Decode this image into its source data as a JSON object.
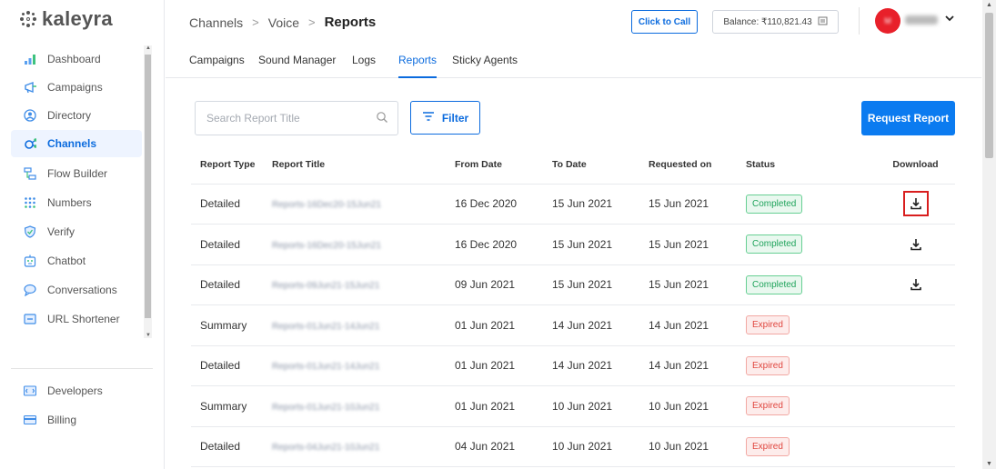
{
  "brand": {
    "name": "kaleyra"
  },
  "sidebar": {
    "items": [
      {
        "label": "Dashboard",
        "icon": "bar-chart-icon"
      },
      {
        "label": "Campaigns",
        "icon": "megaphone-icon"
      },
      {
        "label": "Directory",
        "icon": "contact-icon"
      },
      {
        "label": "Channels",
        "icon": "channels-icon",
        "active": true
      },
      {
        "label": "Flow Builder",
        "icon": "flow-icon"
      },
      {
        "label": "Numbers",
        "icon": "dialpad-icon"
      },
      {
        "label": "Verify",
        "icon": "shield-icon"
      },
      {
        "label": "Chatbot",
        "icon": "chatbot-icon"
      },
      {
        "label": "Conversations",
        "icon": "chat-bubble-icon"
      },
      {
        "label": "URL Shortener",
        "icon": "link-icon"
      }
    ],
    "bottom_items": [
      {
        "label": "Developers",
        "icon": "code-icon"
      },
      {
        "label": "Billing",
        "icon": "card-icon"
      }
    ]
  },
  "header": {
    "breadcrumb": [
      "Channels",
      "Voice",
      "Reports"
    ],
    "click_to_call": "Click to Call",
    "balance": "Balance: ₹110,821.43"
  },
  "tabs": [
    "Campaigns",
    "Sound Manager",
    "Logs",
    "Reports",
    "Sticky Agents"
  ],
  "active_tab": "Reports",
  "search": {
    "placeholder": "Search Report Title"
  },
  "filter_label": "Filter",
  "request_label": "Request Report",
  "table": {
    "columns": [
      "Report Type",
      "Report Title",
      "From Date",
      "To Date",
      "Requested on",
      "Status",
      "Download"
    ],
    "rows": [
      {
        "type": "Detailed",
        "title": "Reports-16Dec20-15Jun21",
        "from": "16 Dec 2020",
        "to": "15 Jun 2021",
        "requested": "15 Jun 2021",
        "status": "Completed"
      },
      {
        "type": "Detailed",
        "title": "Reports-16Dec20-15Jun21",
        "from": "16 Dec 2020",
        "to": "15 Jun 2021",
        "requested": "15 Jun 2021",
        "status": "Completed"
      },
      {
        "type": "Detailed",
        "title": "Reports-09Jun21-15Jun21",
        "from": "09 Jun 2021",
        "to": "15 Jun 2021",
        "requested": "15 Jun 2021",
        "status": "Completed"
      },
      {
        "type": "Summary",
        "title": "Reports-01Jun21-14Jun21",
        "from": "01 Jun 2021",
        "to": "14 Jun 2021",
        "requested": "14 Jun 2021",
        "status": "Expired"
      },
      {
        "type": "Detailed",
        "title": "Reports-01Jun21-14Jun21",
        "from": "01 Jun 2021",
        "to": "14 Jun 2021",
        "requested": "14 Jun 2021",
        "status": "Expired"
      },
      {
        "type": "Summary",
        "title": "Reports-01Jun21-10Jun21",
        "from": "01 Jun 2021",
        "to": "10 Jun 2021",
        "requested": "10 Jun 2021",
        "status": "Expired"
      },
      {
        "type": "Detailed",
        "title": "Reports-04Jun21-10Jun21",
        "from": "04 Jun 2021",
        "to": "10 Jun 2021",
        "requested": "10 Jun 2021",
        "status": "Expired"
      }
    ]
  }
}
